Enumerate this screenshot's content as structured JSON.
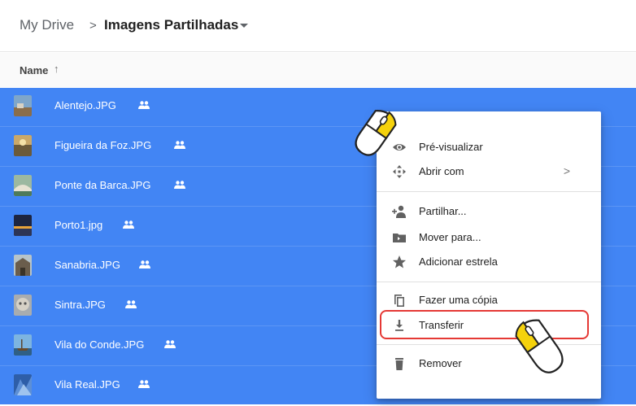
{
  "breadcrumb": {
    "root": "My Drive",
    "separator": ">",
    "current": "Imagens Partilhadas"
  },
  "column_header": {
    "name_label": "Name",
    "sort_arrow": "↑"
  },
  "selection_color": "#4285f4",
  "files": [
    {
      "name": "Alentejo.JPG",
      "shared_icon": "people-icon"
    },
    {
      "name": "Figueira da Foz.JPG",
      "shared_icon": "people-icon"
    },
    {
      "name": "Ponte da Barca.JPG",
      "shared_icon": "people-icon"
    },
    {
      "name": "Porto1.jpg",
      "shared_icon": "people-icon"
    },
    {
      "name": "Sanabria.JPG",
      "shared_icon": "people-icon"
    },
    {
      "name": "Sintra.JPG",
      "shared_icon": "people-icon"
    },
    {
      "name": "Vila do Conde.JPG",
      "shared_icon": "people-icon"
    },
    {
      "name": "Vila Real.JPG",
      "shared_icon": "people-icon"
    }
  ],
  "context_menu": {
    "items": [
      {
        "label": "Pré-visualizar",
        "icon": "eye-icon"
      },
      {
        "label": "Abrir com",
        "icon": "move-arrows-icon",
        "submenu": ">"
      },
      {
        "label": "Partilhar...",
        "icon": "add-person-icon"
      },
      {
        "label": "Mover para...",
        "icon": "folder-move-icon"
      },
      {
        "label": "Adicionar estrela",
        "icon": "star-icon"
      },
      {
        "label": "Fazer uma cópia",
        "icon": "copy-icon"
      },
      {
        "label": "Transferir",
        "icon": "download-icon"
      },
      {
        "label": "Remover",
        "icon": "trash-icon"
      }
    ]
  },
  "annotation": {
    "highlight_color": "#e53935",
    "mouse_click_label": "click"
  }
}
